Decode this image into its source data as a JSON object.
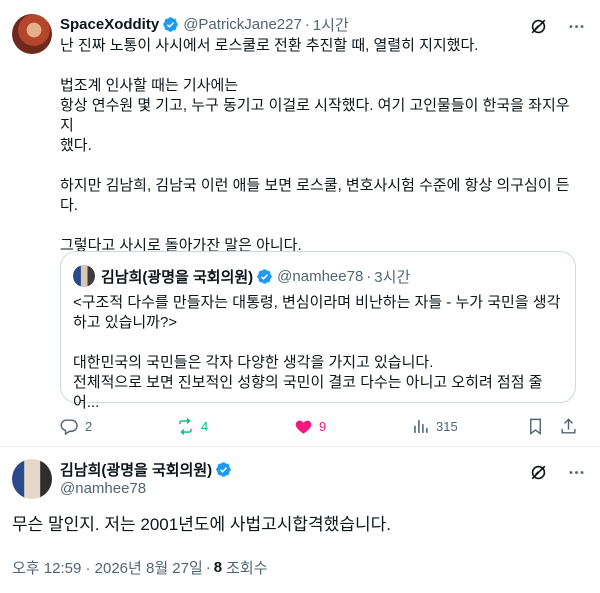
{
  "colors": {
    "accent": "#1d9bf0",
    "retweet": "#00ba7c",
    "like": "#f91880",
    "muted": "#536471",
    "text": "#0f1419",
    "border": "#cfd9de"
  },
  "tweet1": {
    "name": "SpaceXoddity",
    "handle": "@PatrickJane227",
    "time": "1시간",
    "lines": [
      "난 진짜 노통이 사시에서 로스쿨로 전환 추진할 때, 열렬히 지지했다.",
      "",
      "법조계 인사할 때는 기사에는",
      "항상 연수원 몇 기고, 누구 동기고 이걸로 시작했다. 여기 고인물들이 한국을 좌지우지",
      "했다.",
      "",
      "하지만 김남희, 김남국 이런 애들 보면 로스쿨, 변호사시험 수준에 항상 의구심이 든",
      "다.",
      "",
      "그렇다고 사시로 돌아가잔 말은 아니다."
    ],
    "quote": {
      "name": "김남희(광명을 국회의원)",
      "handle": "@namhee78",
      "time": "3시간",
      "lines": [
        "<구조적 다수를 만들자는 대통령, 변심이라며 비난하는 자들 - 누가 국민을 생각",
        "하고 있습니까?>",
        "",
        "대한민국의 국민들은 각자 다양한 생각을 가지고 있습니다.",
        "전체적으로 보면 진보적인 성향의 국민이 결코 다수는 아니고 오히려 점점 줄어..."
      ]
    },
    "actions": {
      "replies": "2",
      "retweets": "4",
      "likes": "9",
      "views": "315"
    },
    "icons": [
      "grok-icon",
      "more-icon",
      "reply-icon",
      "retweet-icon",
      "heart-icon",
      "views-icon",
      "bookmark-icon",
      "share-icon"
    ]
  },
  "tweet2": {
    "name": "김남희(광명을 국회의원)",
    "handle": "@namhee78",
    "text": "무슨 말인지. 저는 2001년도에 사법고시합격했습니다.",
    "timestamp": "오후 12:59 · 2026년 8월 27일",
    "views_count": "8",
    "views_label": "조회수"
  }
}
